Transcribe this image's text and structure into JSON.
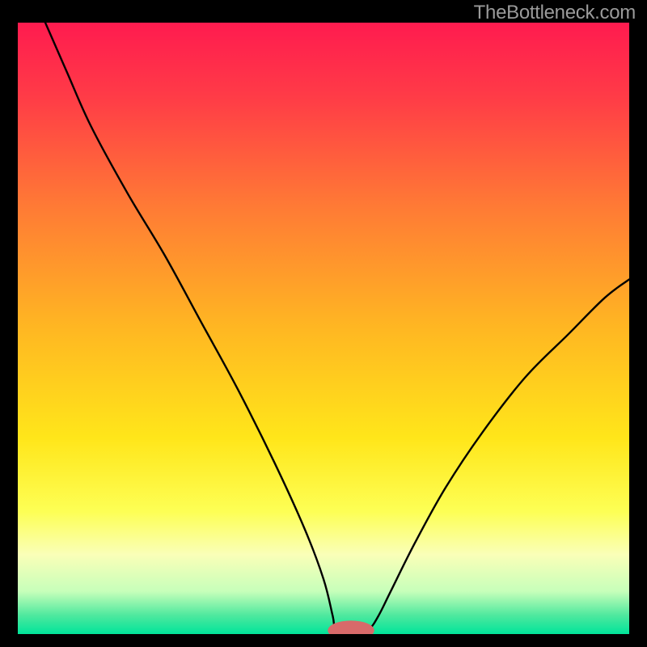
{
  "watermark": "TheBottleneck.com",
  "chart_data": {
    "type": "line",
    "title": "",
    "xlabel": "",
    "ylabel": "",
    "xlim": [
      0,
      100
    ],
    "ylim": [
      0,
      100
    ],
    "background_gradient_stops": [
      {
        "offset": 0.0,
        "color": "#ff1b4f"
      },
      {
        "offset": 0.12,
        "color": "#ff3b47"
      },
      {
        "offset": 0.3,
        "color": "#ff7a35"
      },
      {
        "offset": 0.5,
        "color": "#ffb722"
      },
      {
        "offset": 0.68,
        "color": "#ffe61a"
      },
      {
        "offset": 0.8,
        "color": "#fdff55"
      },
      {
        "offset": 0.87,
        "color": "#faffb8"
      },
      {
        "offset": 0.93,
        "color": "#c7ffba"
      },
      {
        "offset": 0.97,
        "color": "#4de89e"
      },
      {
        "offset": 1.0,
        "color": "#00e49a"
      }
    ],
    "series": [
      {
        "name": "bottleneck-curve",
        "color": "#000000",
        "width": 2.4,
        "points": [
          {
            "x": 4.5,
            "y": 100
          },
          {
            "x": 8,
            "y": 92
          },
          {
            "x": 12,
            "y": 83
          },
          {
            "x": 18,
            "y": 72
          },
          {
            "x": 24,
            "y": 62
          },
          {
            "x": 30,
            "y": 51
          },
          {
            "x": 36,
            "y": 40
          },
          {
            "x": 42,
            "y": 28
          },
          {
            "x": 47,
            "y": 17
          },
          {
            "x": 50,
            "y": 9
          },
          {
            "x": 51.5,
            "y": 3
          },
          {
            "x": 52,
            "y": 0.8
          },
          {
            "x": 54,
            "y": 0.3
          },
          {
            "x": 56,
            "y": 0.3
          },
          {
            "x": 57.5,
            "y": 0.8
          },
          {
            "x": 59,
            "y": 3
          },
          {
            "x": 61,
            "y": 7
          },
          {
            "x": 65,
            "y": 15
          },
          {
            "x": 70,
            "y": 24
          },
          {
            "x": 76,
            "y": 33
          },
          {
            "x": 83,
            "y": 42
          },
          {
            "x": 90,
            "y": 49
          },
          {
            "x": 96,
            "y": 55
          },
          {
            "x": 100,
            "y": 58
          }
        ]
      }
    ],
    "marker": {
      "name": "optimal-point",
      "x": 54.5,
      "y": 0.6,
      "rx": 3.8,
      "ry": 1.6,
      "color": "#d86a6a"
    }
  }
}
